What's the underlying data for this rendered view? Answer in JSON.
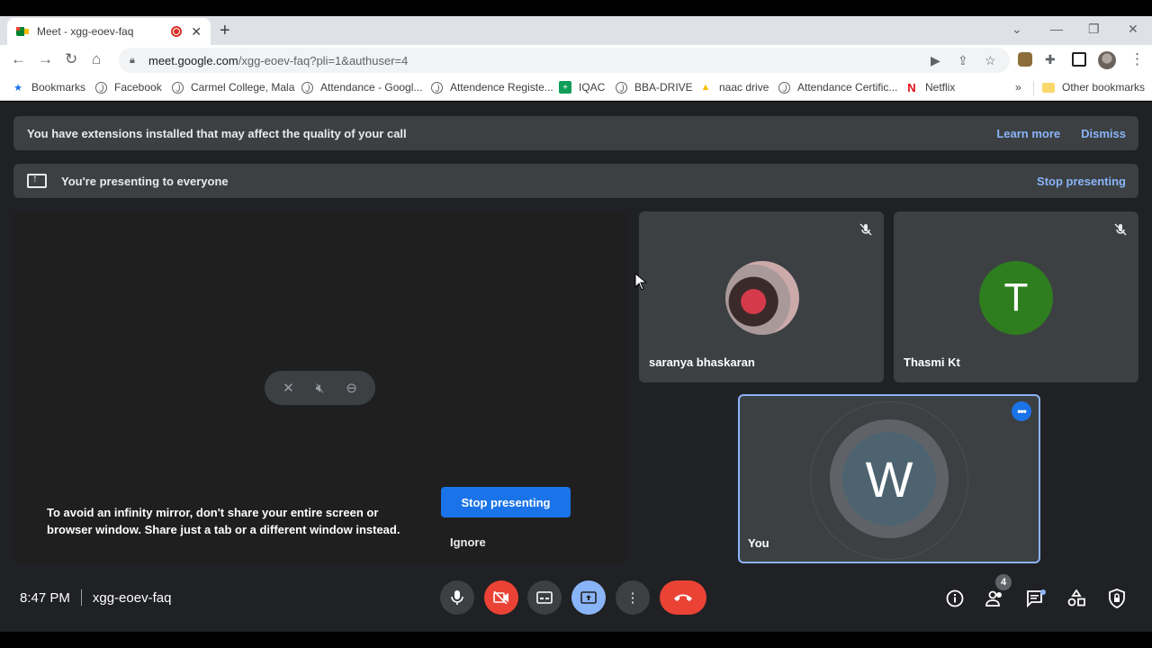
{
  "browser": {
    "tab_title": "Meet - xgg-eoev-faq",
    "new_tab": "+",
    "url_host": "meet.google.com",
    "url_path": "/xgg-eoev-faq?pli=1&authuser=4"
  },
  "bookmarks": [
    {
      "label": "Bookmarks",
      "icon": "star-icon"
    },
    {
      "label": "Facebook",
      "icon": "globe-icon"
    },
    {
      "label": "Carmel College, Mala",
      "icon": "globe-icon"
    },
    {
      "label": "Attendance - Googl...",
      "icon": "globe-icon"
    },
    {
      "label": "Attendence Registe...",
      "icon": "globe-icon"
    },
    {
      "label": "IQAC",
      "icon": "sheets-icon"
    },
    {
      "label": "BBA-DRIVE",
      "icon": "globe-icon"
    },
    {
      "label": "naac drive",
      "icon": "drive-icon"
    },
    {
      "label": "Attendance Certific...",
      "icon": "globe-icon"
    },
    {
      "label": "Netflix",
      "icon": "netflix-icon"
    }
  ],
  "bookmarks_overflow": "»",
  "other_bookmarks": "Other bookmarks",
  "meet": {
    "ext_banner": "You have extensions installed that may affect the quality of your call",
    "learn_more": "Learn more",
    "dismiss": "Dismiss",
    "presenting_banner": "You're presenting to everyone",
    "stop_presenting_link": "Stop presenting",
    "mirror_message": "To avoid an infinity mirror, don't share your entire screen or browser window. Share just a tab or a different window instead.",
    "stop_presenting_button": "Stop presenting",
    "ignore": "Ignore",
    "participants": [
      {
        "name": "saranya bhaskaran",
        "initial": ""
      },
      {
        "name": "Thasmi Kt",
        "initial": "T"
      }
    ],
    "self": {
      "name": "You",
      "initial": "W"
    },
    "time": "8:47 PM",
    "meeting_code": "xgg-eoev-faq",
    "people_count": "4"
  },
  "colors": {
    "meet_bg": "#202124",
    "tile_bg": "#3c4043",
    "accent_blue": "#1a73e8",
    "link_blue": "#8ab4f8",
    "hangup_red": "#ea4335",
    "thasmi_avatar": "#2e7d1f"
  }
}
